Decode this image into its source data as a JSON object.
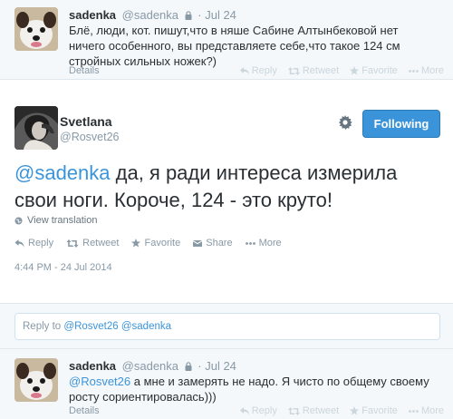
{
  "top_tweet": {
    "name": "sadenka",
    "handle": "@sadenka",
    "date": "· Jul 24",
    "text": "Блё, люди, кот. пишут,что в няше Сабине Алтынбековой нет ничего особенного, вы представляете себе,что такое 124 см стройных сильных ножек?)",
    "details": "Details",
    "actions": {
      "reply": "Reply",
      "retweet": "Retweet",
      "favorite": "Favorite",
      "more": "More"
    }
  },
  "main_tweet": {
    "name": "Svetlana",
    "handle": "@Rosvet26",
    "follow_label": "Following",
    "mention": "@sadenka",
    "text": " да, я ради интереса измерила свои ноги. Короче, 124 - это круто!",
    "view_translation": "View translation",
    "actions": {
      "reply": "Reply",
      "retweet": "Retweet",
      "favorite": "Favorite",
      "share": "Share",
      "more": "More"
    },
    "timestamp": "4:44 PM - 24 Jul 2014"
  },
  "reply_box": {
    "prefix": "Reply to ",
    "mention1": "@Rosvet26",
    "mention2": "@sadenka"
  },
  "bottom_tweet": {
    "name": "sadenka",
    "handle": "@sadenka",
    "date": "· Jul 24",
    "mention": "@Rosvet26",
    "text": " а мне и замерять не надо. Я чисто по общему своему росту сориентировалась)))",
    "details": "Details",
    "actions": {
      "reply": "Reply",
      "retweet": "Retweet",
      "favorite": "Favorite",
      "more": "More"
    }
  },
  "colors": {
    "accent": "#3b94d9",
    "muted": "#8899a6",
    "text": "#292f33",
    "panel": "#f5f8fa"
  },
  "icons": [
    "lock-icon",
    "gear-icon",
    "globe-icon",
    "reply-icon",
    "retweet-icon",
    "star-icon",
    "share-icon",
    "more-icon"
  ]
}
